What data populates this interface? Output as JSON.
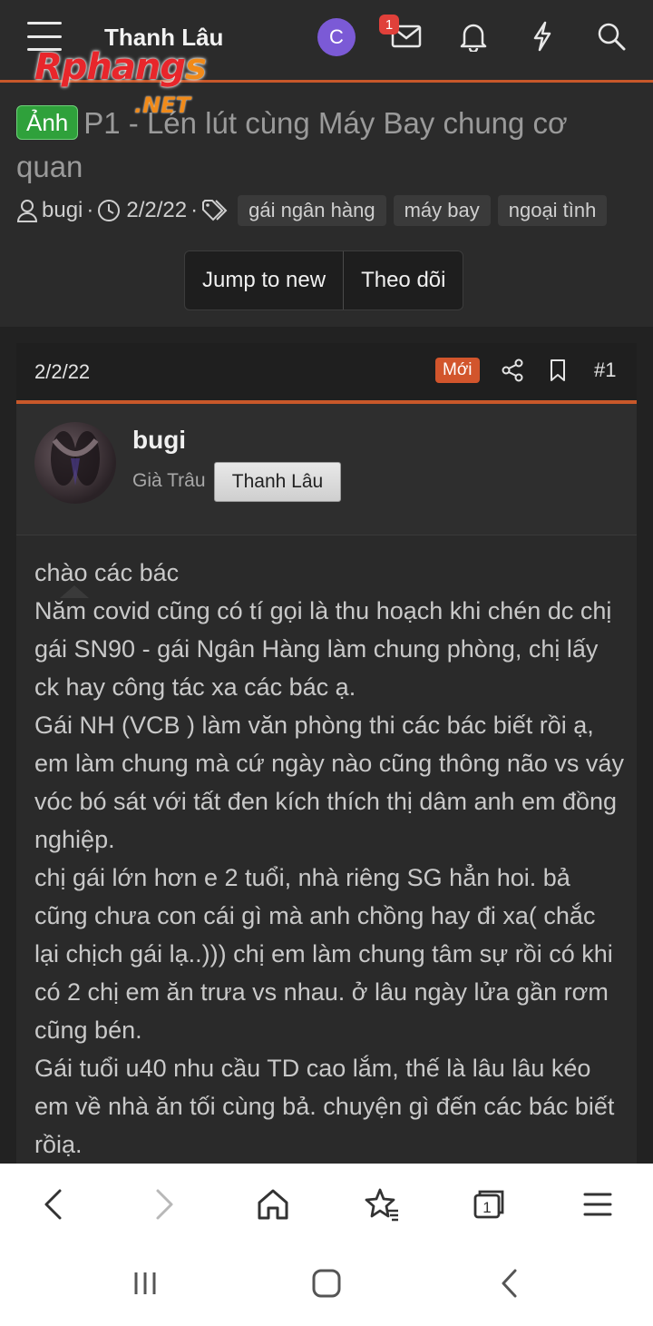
{
  "header": {
    "site_title": "Thanh Lâu",
    "logo_main": "Rphang",
    "logo_s": "s",
    "logo_net": ".NET",
    "avatar_letter": "C",
    "inbox_badge": "1",
    "icons": [
      "menu-icon",
      "mail-icon",
      "bell-icon",
      "lightning-icon",
      "search-icon"
    ]
  },
  "thread": {
    "prefix_label": "Ảnh",
    "title": "P1 - Lén lút cùng Máy Bay chung cơ quan",
    "author": "bugi",
    "date": "2/2/22",
    "tags": [
      "gái ngân hàng",
      "máy bay",
      "ngoại tình"
    ],
    "jump_button": "Jump to new",
    "follow_button": "Theo dõi"
  },
  "post": {
    "date": "2/2/22",
    "new_label": "Mới",
    "number": "#1",
    "username": "bugi",
    "user_title": "Già Trâu",
    "user_banner": "Thanh Lâu",
    "body": [
      "chào các bác",
      "Năm covid cũng có tí gọi là thu hoạch khi chén dc chị gái SN90 - gái Ngân Hàng làm chung phòng, chị lấy ck hay công tác xa các bác ạ.",
      "Gái NH (VCB ) làm văn phòng thi các bác biết rồi ạ, em làm chung mà cứ ngày nào cũng thông não vs váy vóc bó sát với tất đen kích thích thị dâm anh em đồng nghiệp.",
      "chị gái lớn hơn e 2 tuổi, nhà riêng SG hẳn hoi. bả cũng chưa con cái gì mà anh chồng hay đi xa( chắc lại chịch gái lạ..))) chị em làm chung tâm sự rồi có khi có 2 chị em ăn trưa vs nhau. ở lâu ngày lửa gần rơm cũng bén.",
      "Gái tuổi u40 nhu cầu TD cao lắm, thế là lâu lâu kéo em về nhà ăn tối cùng bả. chuyện gì đến các bác biết rồiạ."
    ]
  },
  "browser": {
    "tab_count": "1",
    "icons": [
      "back-icon",
      "forward-icon",
      "home-icon",
      "bookmark-star-icon",
      "tabs-icon",
      "browser-menu-icon"
    ]
  },
  "system": {
    "icons": [
      "recent-apps-icon",
      "home-button-icon",
      "system-back-icon"
    ]
  }
}
